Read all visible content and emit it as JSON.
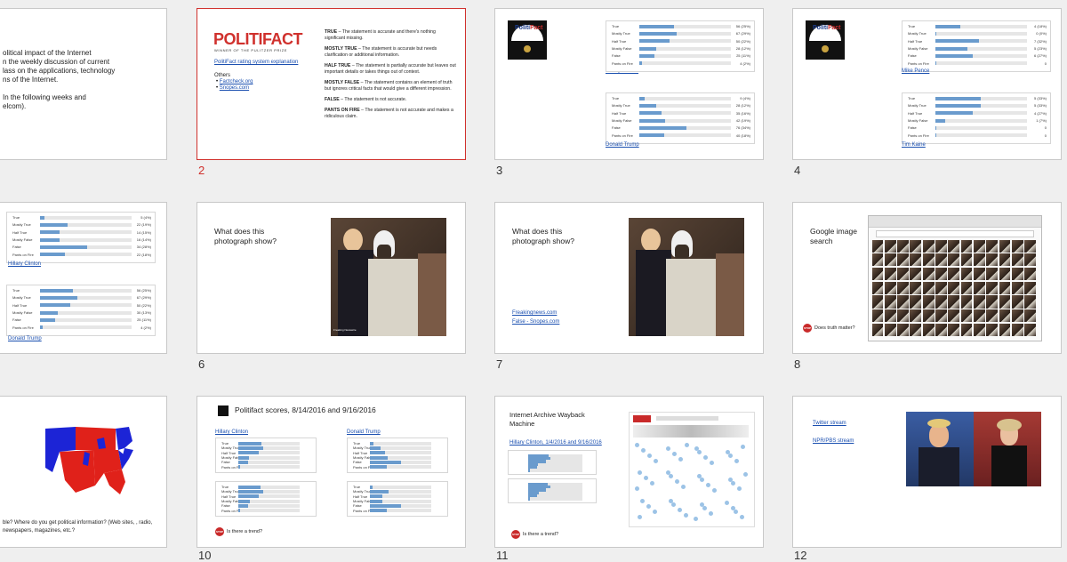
{
  "slide_numbers": [
    "2",
    "3",
    "4",
    "6",
    "7",
    "8",
    "10",
    "11",
    "12"
  ],
  "slide1": {
    "lines": [
      "olitical impact of the Internet",
      "n the weekly discussion of current",
      "lass on the applications, technology",
      "ns of the Internet.",
      "",
      "In the following weeks and",
      "elcom)."
    ]
  },
  "slide2": {
    "logo": "POLITIFACT",
    "logo_sub": "WINNER OF THE PULITZER PRIZE",
    "rating_link": "PolitiFact rating system explanation",
    "others_label": "Others",
    "others": [
      "Factcheck.org",
      "Snopes.com"
    ],
    "definitions": [
      {
        "term": "TRUE",
        "desc": " – The statement is accurate and there's nothing significant missing."
      },
      {
        "term": "MOSTLY TRUE",
        "desc": " – The statement is accurate but needs clarification or additional information."
      },
      {
        "term": "HALF TRUE",
        "desc": " – The statement is partially accurate but leaves out important details or takes things out of context."
      },
      {
        "term": "MOSTLY FALSE",
        "desc": " – The statement contains an element of truth but ignores critical facts that would give a different impression."
      },
      {
        "term": "FALSE",
        "desc": " – The statement is not accurate."
      },
      {
        "term": "PANTS ON FIRE",
        "desc": " – The statement is not accurate and makes a ridiculous claim."
      }
    ]
  },
  "rating_rows": [
    "True",
    "Mostly True",
    "Half True",
    "Mostly False",
    "False",
    "Pants on Fire"
  ],
  "slide3": {
    "card1_name": "Hillary Clinton",
    "card1_values": [
      0.25,
      0.27,
      0.22,
      0.12,
      0.11,
      0.02
    ],
    "card1_labels": [
      "56 (25%)",
      "67 (29%)",
      "50 (22%)",
      "28 (12%)",
      "25 (11%)",
      "4 (2%)"
    ],
    "card2_name": "Donald Trump",
    "card2_values": [
      0.04,
      0.12,
      0.16,
      0.19,
      0.34,
      0.18
    ],
    "card2_labels": [
      "9 (4%)",
      "28 (12%)",
      "35 (16%)",
      "42 (19%)",
      "76 (34%)",
      "40 (18%)"
    ]
  },
  "slide4": {
    "card1_name": "Mike Pence",
    "card1_values": [
      0.18,
      0.0,
      0.32,
      0.23,
      0.27,
      0.0
    ],
    "card1_labels": [
      "4 (18%)",
      "0 (0%)",
      "7 (32%)",
      "5 (23%)",
      "6 (27%)",
      "0"
    ],
    "card2_name": "Tim Kaine",
    "card2_values": [
      0.33,
      0.33,
      0.27,
      0.07,
      0.0,
      0.0
    ],
    "card2_labels": [
      "5 (33%)",
      "5 (33%)",
      "4 (27%)",
      "1 (7%)",
      "0",
      "0"
    ]
  },
  "slide5": {
    "card1_name": "Hillary Clinton",
    "card1_values": [
      0.03,
      0.2,
      0.14,
      0.14,
      0.34,
      0.18
    ],
    "card1_labels": [
      "5 (4%)",
      "22 (19%)",
      "14 (15%)",
      "16 (14%)",
      "34 (28%)",
      "22 (18%)"
    ],
    "card2_name": "Donald Trump",
    "card2_values": [
      0.24,
      0.27,
      0.22,
      0.13,
      0.11,
      0.02
    ],
    "card2_labels": [
      "56 (25%)",
      "67 (29%)",
      "50 (22%)",
      "30 (13%)",
      "25 (11%)",
      "4 (2%)"
    ]
  },
  "slide6": {
    "title": "What does this photograph show?",
    "caption": "Freaking Newswire"
  },
  "slide7": {
    "title": "What does this photograph show?",
    "link1": "Freakingnews.com",
    "link2": "False - Snopes.com"
  },
  "slide8": {
    "title": "Google image search",
    "note": "Does truth matter?",
    "stop": "STOP"
  },
  "slide9": {
    "caption": "ble? Where do you get political information? (Web sites, , radio, newspapers, magazines, etc.?"
  },
  "slide10": {
    "title": "Politifact scores, 8/14/2016 and 9/16/2016",
    "col1": "Hillary Clinton",
    "col2": "Donald Trump",
    "note": "Is there a trend?",
    "stop": "STOP"
  },
  "slide11": {
    "title": "Internet Archive Wayback Machine",
    "subtitle": "Hillary Clinton, 1/4/2016 and 9/16/2016",
    "note": "Is there a trend?",
    "stop": "STOP"
  },
  "slide12": {
    "link1": "Twitter stream",
    "link2": "NPR/PBS stream"
  },
  "colors": {
    "selected_border": "#d0312d",
    "bar": "#6a9bcd",
    "link": "#1a4fb0",
    "map_red": "#e0211a",
    "map_blue": "#1c24d6"
  }
}
